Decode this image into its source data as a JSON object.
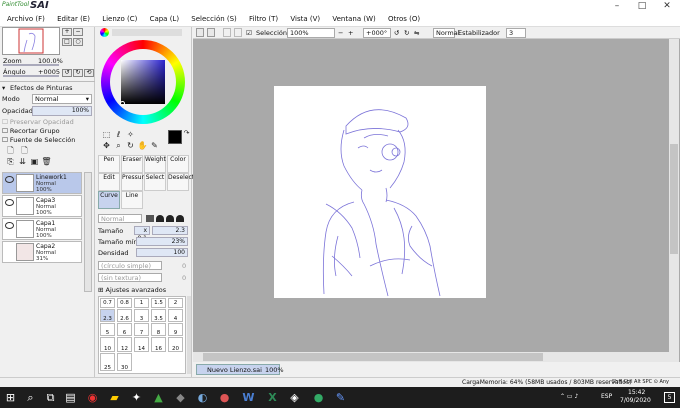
{
  "app": {
    "logo_small": "PaintTool",
    "logo_big": "SAI"
  },
  "window": {
    "min": "–",
    "max": "□",
    "close": "✕"
  },
  "menu": [
    "Archivo (F)",
    "Editar (E)",
    "Lienzo (C)",
    "Capa (L)",
    "Selección (S)",
    "Filtro (T)",
    "Vista (V)",
    "Ventana (W)",
    "Otros (O)"
  ],
  "navigator": {
    "zoom_label": "Zoom",
    "zoom_value": "100.0%",
    "angle_label": "Ángulo",
    "angle_value": "+0005"
  },
  "layer_panel": {
    "effects_label": "Efectos de Pinturas",
    "mode_label": "Modo",
    "mode_value": "Normal",
    "opacity_label": "Opacidad",
    "opacity_value": "100%",
    "preserve": "Preservar Opacidad",
    "clip": "Recortar Grupo",
    "source": "Fuente de Selección",
    "layers": [
      {
        "name": "Linework1",
        "mode": "Normal",
        "opacity": "100%"
      },
      {
        "name": "Capa3",
        "mode": "Normal",
        "opacity": "100%"
      },
      {
        "name": "Capa1",
        "mode": "Normal",
        "opacity": "100%"
      },
      {
        "name": "Capa2",
        "mode": "Normal",
        "opacity": "31%"
      }
    ]
  },
  "tools": {
    "row1": [
      "Pen",
      "Eraser",
      "Weight",
      "Color"
    ],
    "row2": [
      "Edit",
      "Pressure",
      "Select",
      "Deselect"
    ],
    "row3": [
      "Curve",
      "Line"
    ]
  },
  "brush_settings": {
    "blend_mode": "Normal",
    "size_label": "Tamaño",
    "size_mult": "x 0.1",
    "size_value": "2.3",
    "min_label": "Tamaño mín.",
    "min_value": "23%",
    "density_label": "Densidad",
    "density_value": "100",
    "shape1": "(círculo simple)",
    "shape1_val": "0",
    "shape2": "(sin textura)",
    "shape2_val": "0",
    "advanced": "Ajustes avanzados",
    "sizes": [
      "0.7",
      "0.8",
      "1",
      "1.5",
      "2",
      "2.3",
      "2.6",
      "3",
      "3.5",
      "4",
      "5",
      "6",
      "7",
      "8",
      "9",
      "10",
      "12",
      "14",
      "16",
      "20",
      "25",
      "30"
    ]
  },
  "canvas_toolbar": {
    "selection_label": "Selección",
    "zoom": "100%",
    "angle": "+000°",
    "blend": "Normal",
    "stabilizer_label": "Estabilizador",
    "stabilizer_value": "3"
  },
  "document_tab": {
    "name": "Nuevo Lienzo.sai",
    "zoom": "100%"
  },
  "status": {
    "memory": "CargaMemoria: 64% (58MB usados / 803MB reservados)",
    "keys": "Shft Ctrl Alt SPC ⊙ Any"
  },
  "taskbar": {
    "lang": "ESP",
    "time": "15:42",
    "date": "7/09/2020",
    "notif": "5"
  },
  "colors": {
    "accent": "#b9c8ea",
    "stroke": "#7b73d8"
  }
}
